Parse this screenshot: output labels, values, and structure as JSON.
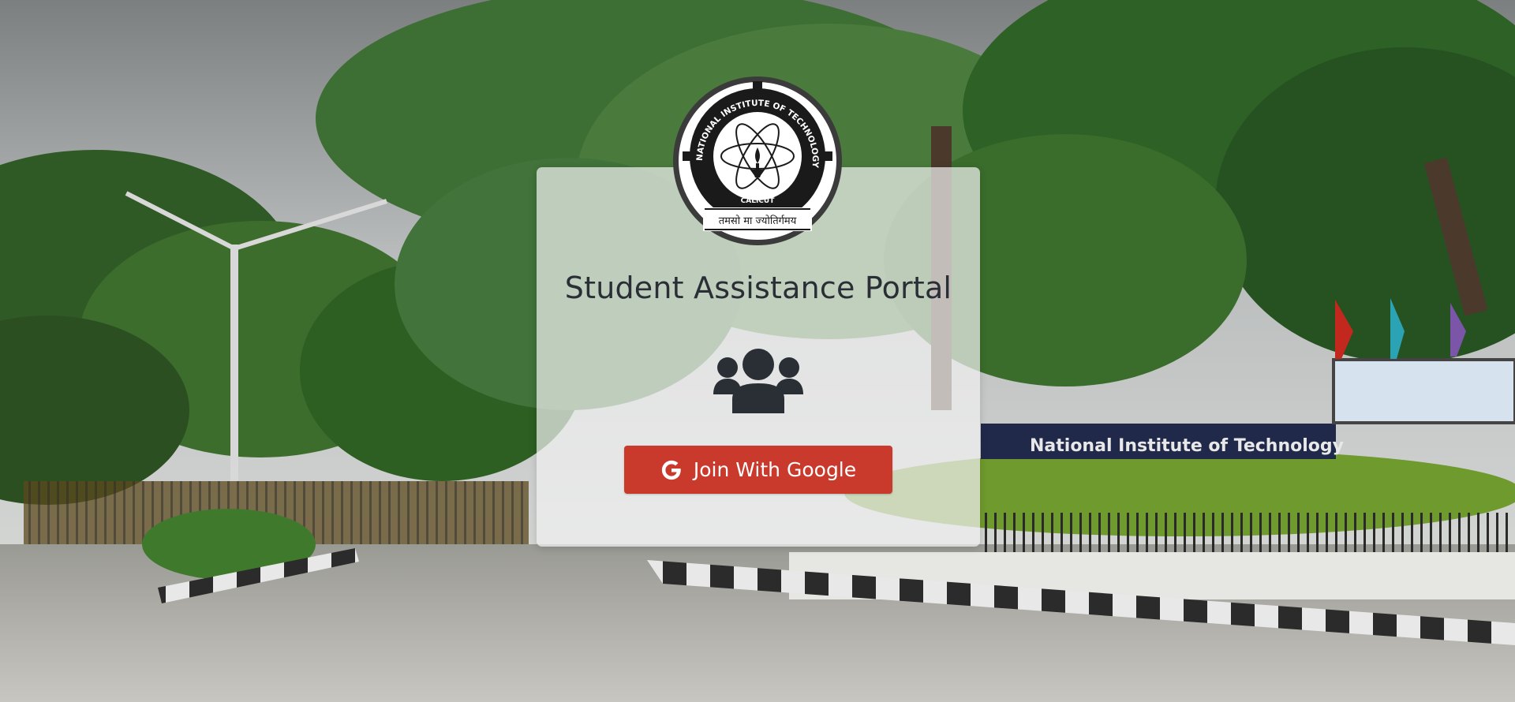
{
  "portal": {
    "title": "Student Assistance Portal",
    "join_button_label": "Join With Google"
  },
  "logo": {
    "institution_ring_text": "NATIONAL INSTITUTE OF TECHNOLOGY",
    "city_text": "CALICUT",
    "motto_text": "तमसो मा ज्योतिर्गमय"
  },
  "background": {
    "signboard_text": "National Institute of Technology"
  },
  "icons": {
    "users": "users-icon",
    "google": "google-icon",
    "logo": "nitc-logo"
  },
  "colors": {
    "button": "#c9392c",
    "card": "#f0f0f0",
    "title_text": "#2a2f36",
    "icon": "#2a2f36"
  }
}
